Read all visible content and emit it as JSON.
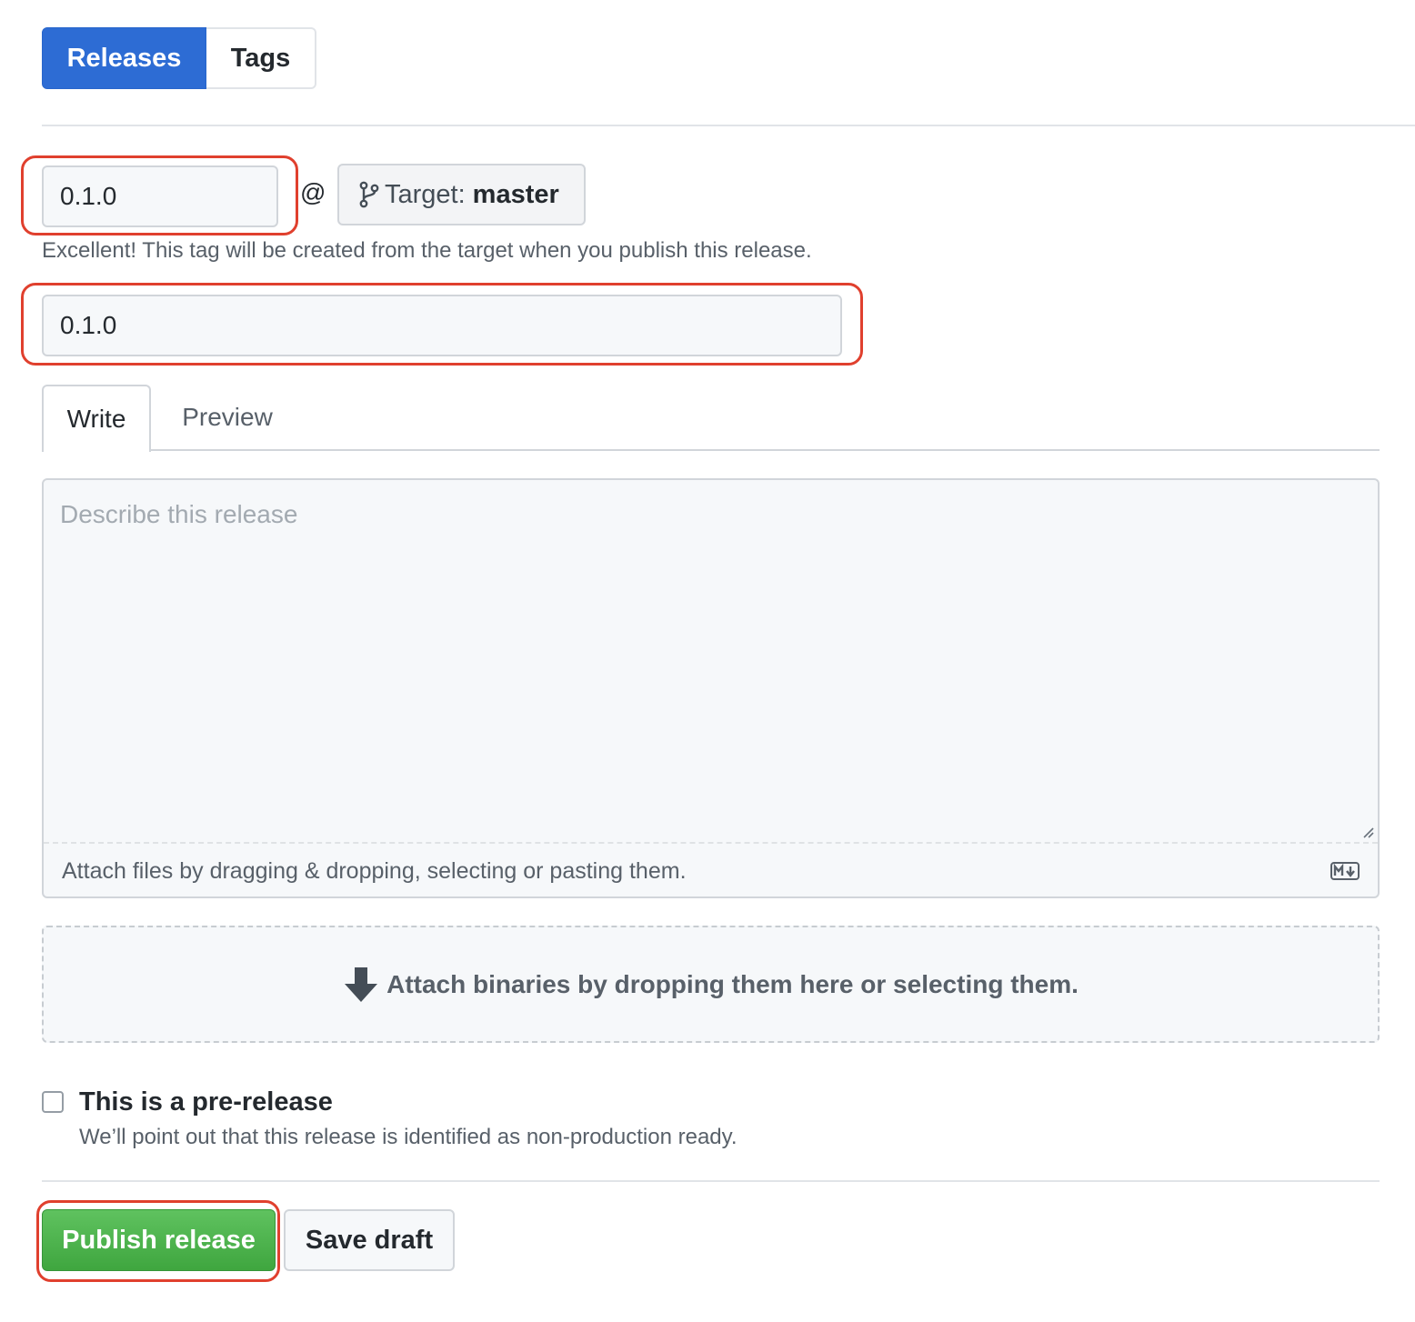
{
  "subnav": {
    "releases": "Releases",
    "tags": "Tags"
  },
  "tag": {
    "value": "0.1.0",
    "separator": "@",
    "target_prefix": "Target:",
    "target_branch": "master",
    "note": "Excellent! This tag will be created from the target when you publish this release."
  },
  "title": {
    "value": "0.1.0"
  },
  "editor": {
    "tabs": {
      "write": "Write",
      "preview": "Preview"
    },
    "placeholder": "Describe this release",
    "attach_text": "Attach files by dragging & dropping, selecting or pasting them.",
    "markdown_icon": "markdown-icon"
  },
  "binaries": {
    "text": "Attach binaries by dropping them here or selecting them.",
    "icon": "arrow-down-icon"
  },
  "prerelease": {
    "checked": false,
    "label": "This is a pre-release",
    "description": "We’ll point out that this release is identified as non-production ready."
  },
  "actions": {
    "publish": "Publish release",
    "save_draft": "Save draft"
  },
  "colors": {
    "primary_blue": "#2d6cd4",
    "publish_green": "#4bb34b",
    "highlight_red": "#e0402e"
  }
}
